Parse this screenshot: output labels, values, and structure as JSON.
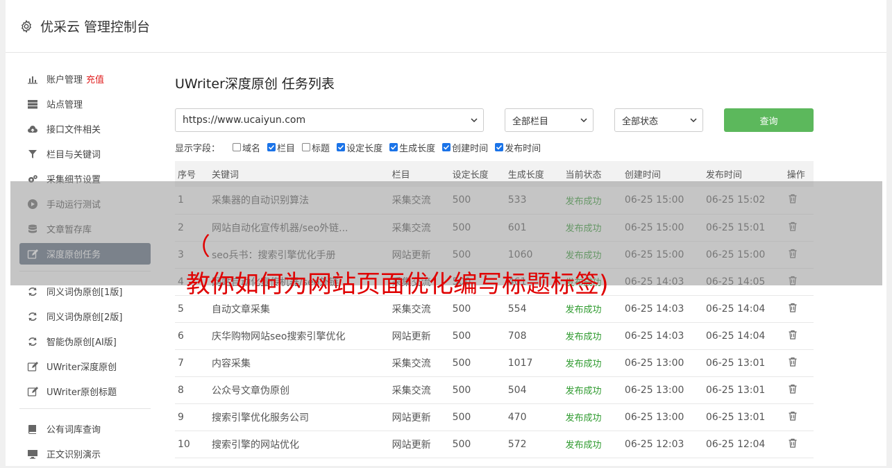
{
  "header": {
    "title": "优采云 管理控制台",
    "icon": "gear-icon"
  },
  "sidebar": {
    "group1": [
      {
        "label": "账户管理",
        "tag": "充值",
        "icon": "bar-chart-icon",
        "active": false
      },
      {
        "label": "站点管理",
        "icon": "server-icon",
        "active": false
      },
      {
        "label": "接口文件相关",
        "icon": "cloud-upload-icon",
        "active": false
      },
      {
        "label": "栏目与关键词",
        "icon": "filter-icon",
        "active": false
      },
      {
        "label": "采集细节设置",
        "icon": "gears-icon",
        "active": false
      },
      {
        "label": "手动运行测试",
        "icon": "play-icon",
        "active": false
      },
      {
        "label": "文章暂存库",
        "icon": "database-icon",
        "active": false
      },
      {
        "label": "深度原创任务",
        "icon": "edit-icon",
        "active": true
      }
    ],
    "group2": [
      {
        "label": "同义词伪原创[1版]",
        "icon": "refresh-icon"
      },
      {
        "label": "同义词伪原创[2版]",
        "icon": "refresh-icon"
      },
      {
        "label": "智能伪原创[AI版]",
        "icon": "refresh-icon"
      },
      {
        "label": "UWriter深度原创",
        "icon": "edit-icon"
      },
      {
        "label": "UWriter原创标题",
        "icon": "edit-icon"
      }
    ],
    "group3": [
      {
        "label": "公有词库查询",
        "icon": "book-icon"
      },
      {
        "label": "正文识别演示",
        "icon": "monitor-icon"
      }
    ]
  },
  "main": {
    "title": "UWriter深度原创 任务列表",
    "filters": {
      "site": "https://www.ucaiyun.com",
      "category": "全部栏目",
      "status": "全部状态",
      "query_label": "查询"
    },
    "fields_label": "显示字段：",
    "fields": [
      {
        "label": "域名",
        "checked": false
      },
      {
        "label": "栏目",
        "checked": true
      },
      {
        "label": "标题",
        "checked": false
      },
      {
        "label": "设定长度",
        "checked": true
      },
      {
        "label": "生成长度",
        "checked": true
      },
      {
        "label": "创建时间",
        "checked": true
      },
      {
        "label": "发布时间",
        "checked": true
      }
    ],
    "table": {
      "headers": [
        "序号",
        "关键词",
        "栏目",
        "设定长度",
        "生成长度",
        "当前状态",
        "创建时间",
        "发布时间",
        "操作"
      ],
      "rows": [
        [
          "1",
          "采集器的自动识别算法",
          "采集交流",
          "500",
          "533",
          "发布成功",
          "06-25 15:00",
          "06-25 15:02"
        ],
        [
          "2",
          "网站自动化宣传机器/seo外链...",
          "采集交流",
          "500",
          "601",
          "发布成功",
          "06-25 15:00",
          "06-25 15:01"
        ],
        [
          "3",
          "seo兵书：搜索引擎优化手册",
          "网站更新",
          "500",
          "1060",
          "发布成功",
          "06-25 15:00",
          "06-25 15:00"
        ],
        [
          "4",
          "网站自动化宣传机器/seo外链",
          "采集交流",
          "500",
          "461",
          "发布成功",
          "06-25 14:03",
          "06-25 14:05"
        ],
        [
          "5",
          "自动文章采集",
          "采集交流",
          "500",
          "554",
          "发布成功",
          "06-25 14:03",
          "06-25 14:04"
        ],
        [
          "6",
          "庆华购物网站seo搜索引擎优化",
          "网站更新",
          "500",
          "708",
          "发布成功",
          "06-25 14:03",
          "06-25 14:04"
        ],
        [
          "7",
          "内容采集",
          "采集交流",
          "500",
          "1017",
          "发布成功",
          "06-25 13:00",
          "06-25 13:01"
        ],
        [
          "8",
          "公众号文章伪原创",
          "采集交流",
          "500",
          "504",
          "发布成功",
          "06-25 13:00",
          "06-25 13:01"
        ],
        [
          "9",
          "搜索引擎优化服务公司",
          "网站更新",
          "500",
          "470",
          "发布成功",
          "06-25 13:00",
          "06-25 13:01"
        ],
        [
          "10",
          "搜索引擎的网站优化",
          "网站更新",
          "500",
          "572",
          "发布成功",
          "06-25 12:03",
          "06-25 12:04"
        ]
      ]
    }
  },
  "overlay": {
    "line1": "（",
    "line2": "教你如何为网站页面优化编写标题标签)"
  },
  "colors": {
    "active_nav": "#5c6a7e",
    "query_button": "#5cb85c",
    "success": "#2e9a2e",
    "recharge": "#e02020",
    "overlay_text": "#e00000"
  }
}
